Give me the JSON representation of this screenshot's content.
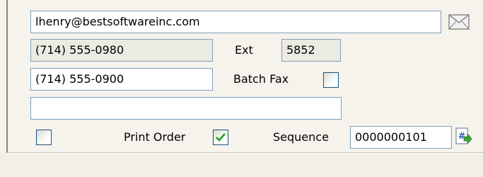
{
  "contact": {
    "email": "lhenry@bestsoftwareinc.com",
    "email_icon": "envelope-icon",
    "phone": "(714) 555-0980",
    "ext_label": "Ext",
    "ext": "5852",
    "fax": "(714) 555-0900",
    "batch_fax_label": "Batch Fax",
    "batch_fax_checked": false,
    "extra": "",
    "extra_checkbox_checked": false,
    "print_order_label": "Print Order",
    "print_order_checked": true,
    "sequence_label": "Sequence",
    "sequence": "0000000101",
    "sequence_icon": "next-number-icon"
  },
  "colors": {
    "check": "#21a121",
    "field_border": "#7f9db9",
    "checkbox_border": "#1c5180"
  }
}
